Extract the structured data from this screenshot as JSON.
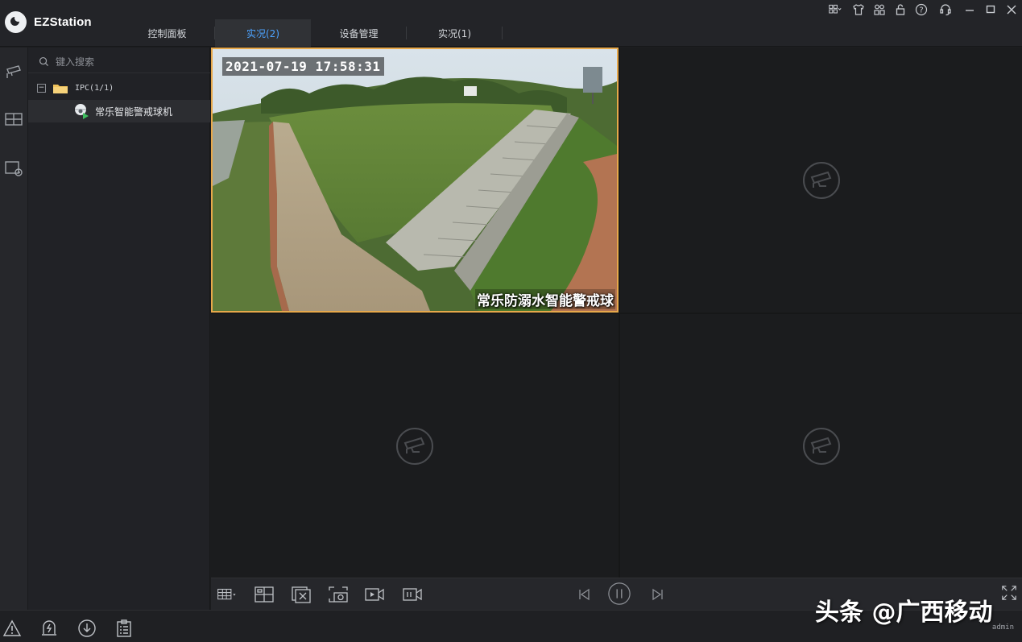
{
  "app": {
    "title": "EZStation"
  },
  "tabs": [
    {
      "label": "控制面板",
      "active": false
    },
    {
      "label": "实况(2)",
      "active": true
    },
    {
      "label": "设备管理",
      "active": false
    },
    {
      "label": "实况(1)",
      "active": false
    }
  ],
  "window_icons": [
    "layout-grid-icon",
    "skin-shirt-icon",
    "user-group-icon",
    "lock-icon",
    "help-icon",
    "support-icon",
    "minimize-icon",
    "maximize-icon",
    "close-icon"
  ],
  "rail": [
    "live-camera-icon",
    "video-wall-icon",
    "playback-icon"
  ],
  "tree": {
    "search_placeholder": "键入搜索",
    "group": {
      "label": "IPC(1/1)",
      "expanded": true
    },
    "device": {
      "label": "常乐智能警戒球机"
    }
  },
  "video": {
    "timestamp": "2021-07-19 17:58:31",
    "channel_name": "常乐防溺水智能警戒球"
  },
  "toolbar": {
    "left": [
      "layout-select-icon",
      "window-split-icon",
      "close-all-icon",
      "snapshot-icon",
      "record-icon",
      "local-record-icon"
    ],
    "center": [
      "prev-icon",
      "pause-icon",
      "next-icon"
    ],
    "right": [
      "fullscreen-icon"
    ]
  },
  "statusbar": {
    "icons": [
      "alarm-icon",
      "device-event-icon",
      "download-icon",
      "log-icon"
    ],
    "user": "admin"
  },
  "watermark": "头条 @广西移动",
  "colors": {
    "accent": "#4da3ff",
    "selected_border": "#e7a84a",
    "background": "#1c1d1f"
  }
}
